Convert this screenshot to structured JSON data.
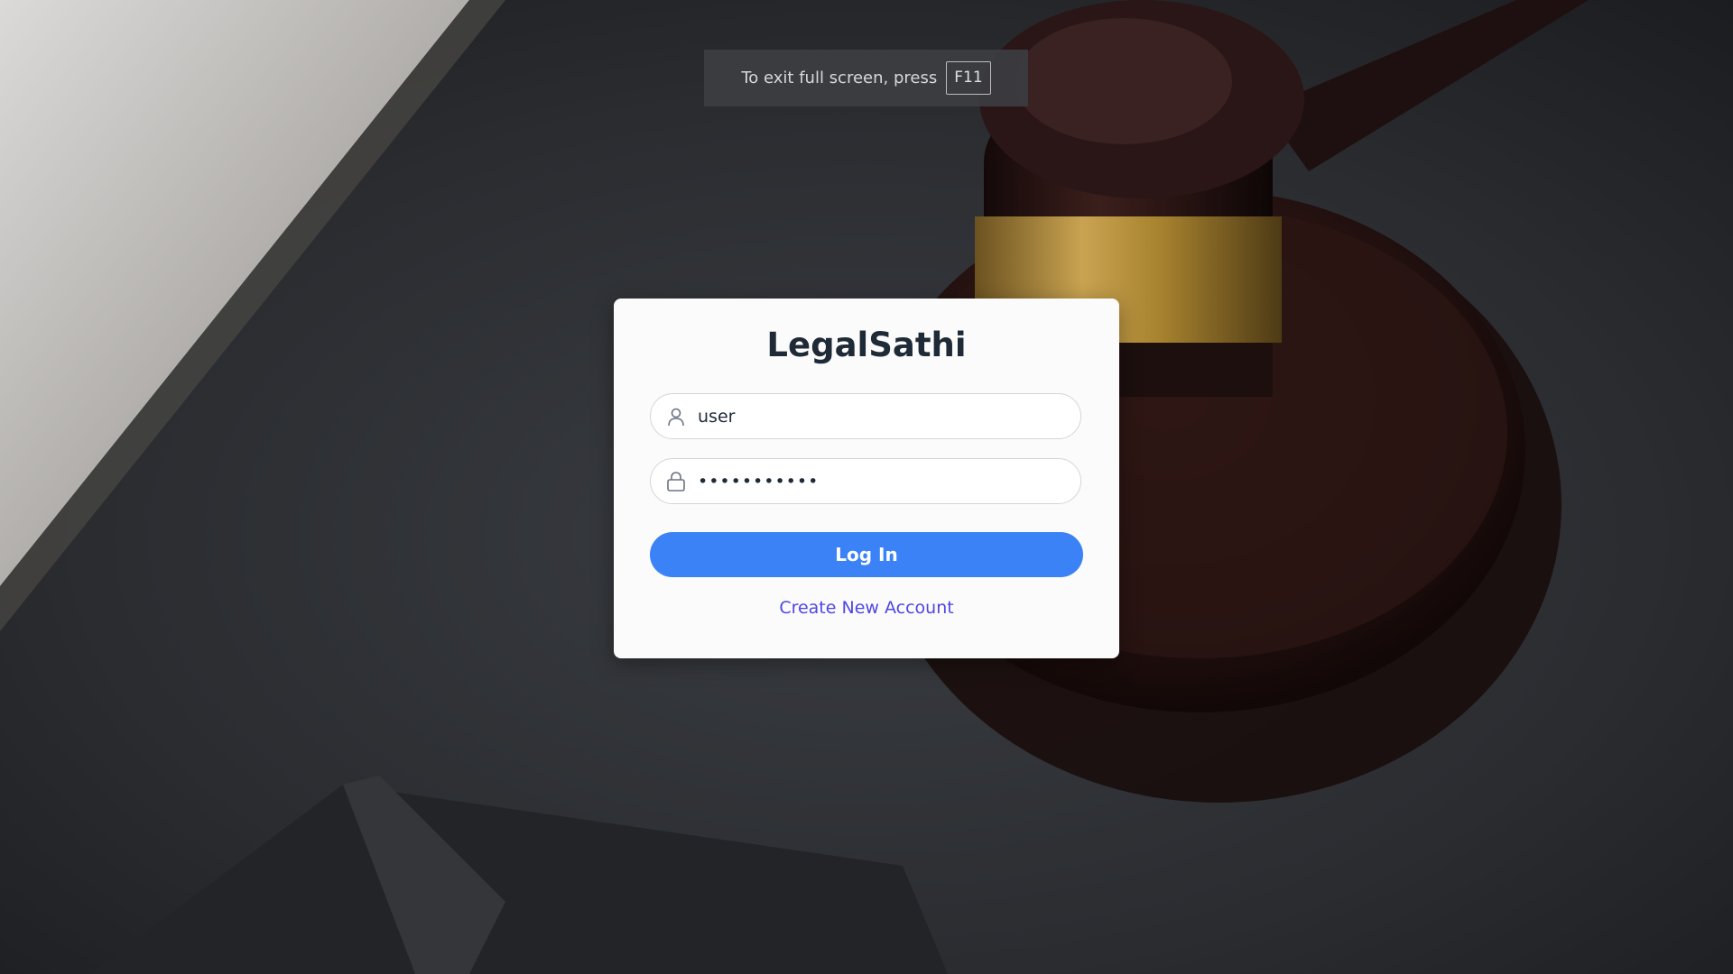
{
  "fullscreen_notice": {
    "text": "To exit full screen, press",
    "key": "F11"
  },
  "login": {
    "title": "LegalSathi",
    "username_value": "user",
    "password_value": "•••••••••••",
    "login_label": "Log In",
    "create_account_label": "Create New Account"
  },
  "icons": {
    "username": "user-icon",
    "password": "lock-icon"
  },
  "colors": {
    "primary_button": "#3b82f6",
    "link": "#4f46e5",
    "title": "#1f2a37",
    "card_background": "#fbfbfb"
  }
}
